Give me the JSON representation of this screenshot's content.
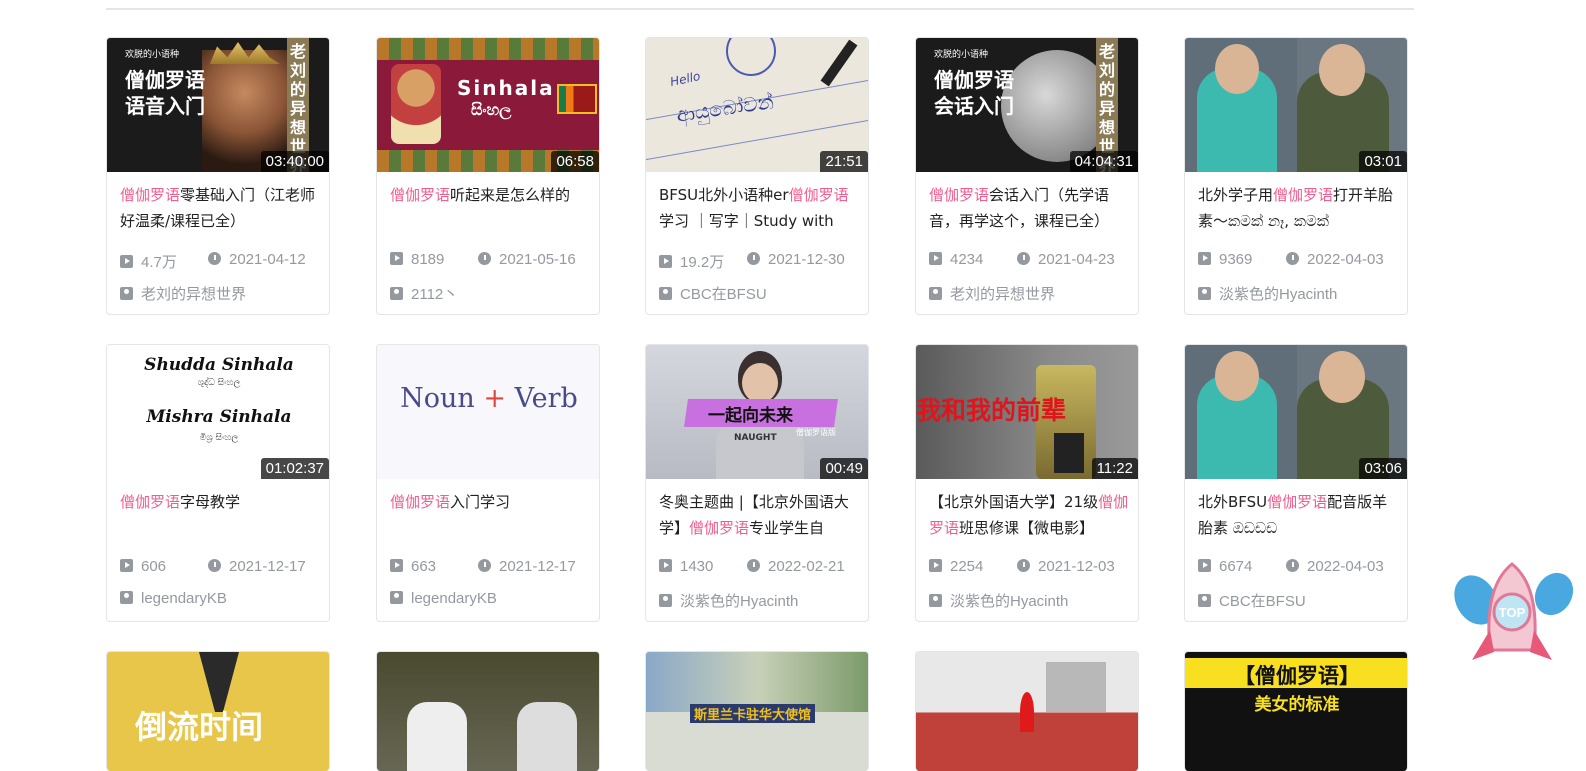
{
  "cards": [
    {
      "title_hl": "僧伽罗语",
      "title_rest": "零基础入门（江老师好温柔/课程已全）",
      "duration": "03:40:00",
      "views": "4.7万",
      "date": "2021-04-12",
      "author": "老刘的异想世界",
      "thumb": {
        "bg": "#1b1b1b",
        "small": "欢脱的小语种",
        "big1": "僧伽罗语",
        "big2": "语音入门",
        "side": "老刘的异想世界"
      }
    },
    {
      "title_hl": "僧伽罗语",
      "title_rest": "听起来是怎么样的",
      "duration": "06:58",
      "views": "8189",
      "date": "2021-05-16",
      "author": "2112丶",
      "thumb": {
        "bg": "#8b1a3a",
        "word": "Sinhala",
        "native": "සිංහල"
      }
    },
    {
      "title_pre": "BFSU北外小语种er",
      "title_hl": "僧伽罗语",
      "title_rest": "学习 ｜写字｜Study with",
      "duration": "21:51",
      "views": "19.2万",
      "date": "2021-12-30",
      "author": "CBC在BFSU",
      "thumb": {
        "bg": "#ece7dc",
        "hello": "Hello",
        "script": "ආයුබෝවන්"
      }
    },
    {
      "title_hl": "僧伽罗语",
      "title_rest": "会话入门（先学语音，再学这个，课程已全）",
      "duration": "04:04:31",
      "views": "4234",
      "date": "2021-04-23",
      "author": "老刘的异想世界",
      "thumb": {
        "bg": "#1b1b1b",
        "small": "欢脱的小语种",
        "big1": "僧伽罗语",
        "big2": "会话入门",
        "side": "老刘的异想世界"
      }
    },
    {
      "title_pre": "北外学子用",
      "title_hl": "僧伽罗语",
      "title_rest": "打开羊胎素～කමක් නෑ, කමක්",
      "duration": "03:01",
      "views": "9369",
      "date": "2022-04-03",
      "author": "淡紫色的Hyacinth",
      "thumb": {
        "bg": "#5a6a6a"
      }
    },
    {
      "title_hl": "僧伽罗语",
      "title_rest": "字母教学",
      "duration": "01:02:37",
      "views": "606",
      "date": "2021-12-17",
      "author": "legendaryKB",
      "thumb": {
        "bg": "#ffffff",
        "l1": "Shudda Sinhala",
        "l1s": "ශුද්ධ සිංහල",
        "l2": "Mishra Sinhala",
        "l2s": "මිශ්‍ර සිංහල"
      }
    },
    {
      "title_hl": "僧伽罗语",
      "title_rest": "入门学习",
      "duration": "",
      "views": "663",
      "date": "2021-12-17",
      "author": "legendaryKB",
      "thumb": {
        "bg": "#f8f7fb",
        "noun": "Noun",
        "plus": "+",
        "verb": "Verb"
      }
    },
    {
      "title_pre": "冬奥主题曲 |【北京外国语大学】",
      "title_hl": "僧伽罗语",
      "title_rest": "专业学生自",
      "duration": "00:49",
      "views": "1430",
      "date": "2022-02-21",
      "author": "淡紫色的Hyacinth",
      "thumb": {
        "bg": "#c8cad2",
        "banner": "一起向未来",
        "tag": "僧伽罗语版",
        "shirt": "NAUGHT"
      }
    },
    {
      "title_pre": "【北京外国语大学】21级",
      "title_hl": "僧伽罗语",
      "title_rest": "班思修课【微电影】",
      "duration": "11:22",
      "views": "2254",
      "date": "2021-12-03",
      "author": "淡紫色的Hyacinth",
      "thumb": {
        "bg": "#6e6e6e",
        "red": "我和我的前辈"
      }
    },
    {
      "title_pre": "北外BFSU",
      "title_hl": "僧伽罗语",
      "title_rest": "配音版羊胎素 ඔඩඩඩ",
      "duration": "03:06",
      "views": "6674",
      "date": "2022-04-03",
      "author": "CBC在BFSU",
      "thumb": {
        "bg": "#5a6a6a"
      }
    }
  ],
  "partial_cards": [
    {
      "bg": "#e8c64a",
      "text": "倒流时间"
    },
    {
      "bg": "#3b3a30",
      "text": ""
    },
    {
      "bg": "#d8dcd2",
      "text": "斯里兰卡驻华大使馆"
    },
    {
      "bg": "#c0413a",
      "text": ""
    },
    {
      "bg": "#111111",
      "text": "【僧伽罗语】",
      "text2": "美女的标准"
    }
  ],
  "top_button": {
    "label": "TOP"
  },
  "colors": {
    "highlight": "#f25d8e",
    "meta": "#9499a0"
  }
}
